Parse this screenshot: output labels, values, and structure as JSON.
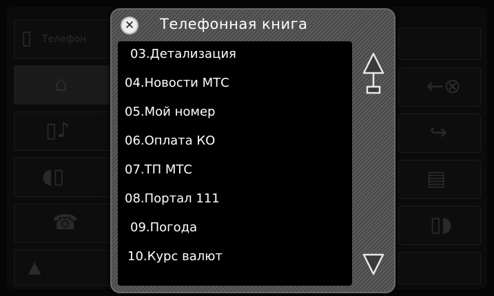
{
  "dialog": {
    "title": "Телефонная книга",
    "close_icon": "close-icon"
  },
  "background": {
    "phone_label": "Телефон"
  },
  "list": {
    "items": [
      {
        "label": "03.Детализация"
      },
      {
        "label": "04.Новости МТС"
      },
      {
        "label": "05.Мой номер"
      },
      {
        "label": "06.Оплата КО"
      },
      {
        "label": "07.ТП МТС"
      },
      {
        "label": "08.Портал 111"
      },
      {
        "label": "09.Погода"
      },
      {
        "label": "10.Курс валют"
      }
    ]
  },
  "scroll": {
    "up_icon": "scroll-up-arrow-icon",
    "down_icon": "scroll-down-arrow-icon"
  },
  "colors": {
    "dialog_frame": "#5c5c5c",
    "list_background": "#000000",
    "text": "#ffffff"
  }
}
